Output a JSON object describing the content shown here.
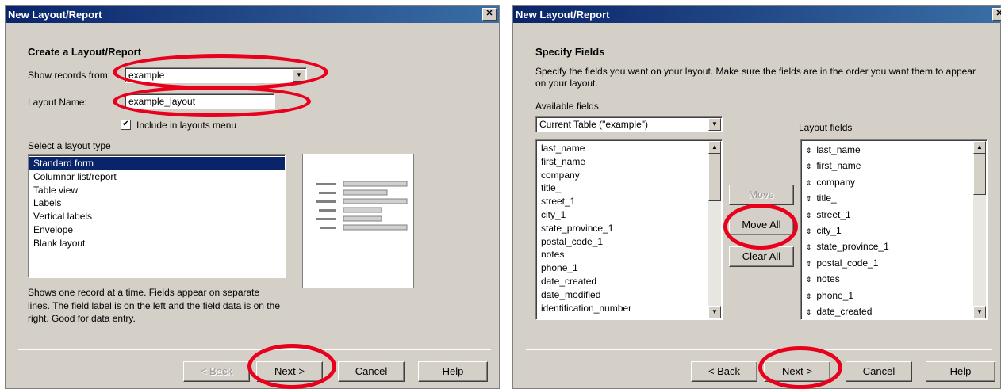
{
  "left_dialog": {
    "title": "New Layout/Report",
    "close_glyph": "✕",
    "heading": "Create a Layout/Report",
    "show_records_label": "Show records from:",
    "show_records_value": "example",
    "layout_name_label": "Layout Name:",
    "layout_name_value": "example_layout",
    "include_menu_label": "Include in layouts menu",
    "include_menu_checked": true,
    "select_type_label": "Select a layout type",
    "layout_types": [
      "Standard form",
      "Columnar list/report",
      "Table view",
      "Labels",
      "Vertical labels",
      "Envelope",
      "Blank layout"
    ],
    "selected_type": "Standard form",
    "description": "Shows one record at a time. Fields appear on separate lines.  The field label is on the left and the field data is on the right.  Good for data entry.",
    "buttons": {
      "back": "< Back",
      "next": "Next >",
      "cancel": "Cancel",
      "help": "Help"
    }
  },
  "right_dialog": {
    "title": "New Layout/Report",
    "close_glyph": "✕",
    "heading": "Specify Fields",
    "instructions": "Specify the fields you want on your layout. Make sure the fields are in the order you want them to appear on your layout.",
    "available_label": "Available fields",
    "table_select_value": "Current Table (\"example\")",
    "available_fields": [
      "last_name",
      "first_name",
      "company",
      "title_",
      "street_1",
      "city_1",
      "state_province_1",
      "postal_code_1",
      "notes",
      "phone_1",
      "date_created",
      "date_modified",
      "identification_number"
    ],
    "layout_fields_label": "Layout fields",
    "layout_fields": [
      "last_name",
      "first_name",
      "company",
      "title_",
      "street_1",
      "city_1",
      "state_province_1",
      "postal_code_1",
      "notes",
      "phone_1",
      "date_created"
    ],
    "move_button": "Move",
    "move_all_button": "Move All",
    "clear_all_button": "Clear All",
    "buttons": {
      "back": "< Back",
      "next": "Next >",
      "cancel": "Cancel",
      "help": "Help"
    }
  },
  "colors": {
    "title_bar": "#0a246a",
    "selection": "#0a246a",
    "annotation": "#e8001c",
    "dialog_bg": "#d4d0c8"
  },
  "icons": {
    "scroll_up": "▲",
    "scroll_down": "▼",
    "combo_arrow": "▼",
    "check": "✔",
    "drag_handle": "⇕"
  }
}
